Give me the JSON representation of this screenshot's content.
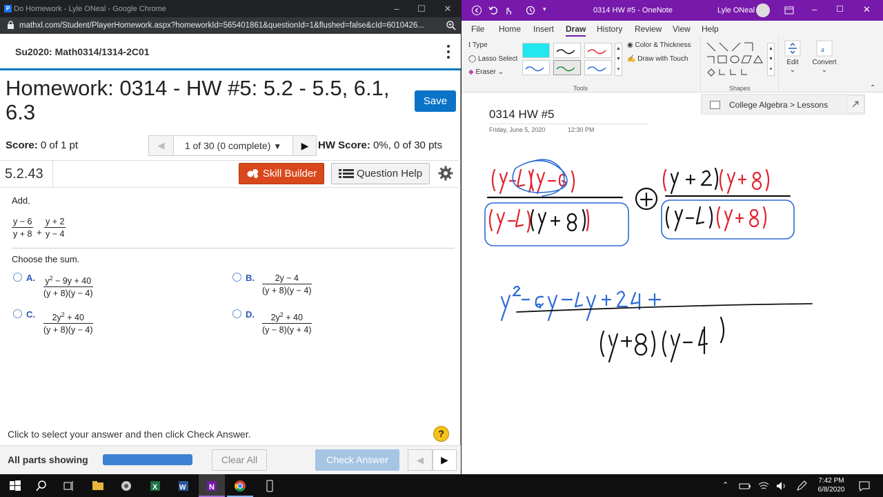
{
  "chrome": {
    "window_title": "Do Homework - Lyle ONeal - Google Chrome",
    "url": "mathxl.com/Student/PlayerHomework.aspx?homeworkId=565401861&questionId=1&flushed=false&cId=6010426...",
    "favicon_letter": "P"
  },
  "course": {
    "name": "Su2020: Math0314/1314-2C01"
  },
  "homework": {
    "title": "Homework: 0314 - HW #5: 5.2 - 5.5, 6.1, 6.3",
    "save_label": "Save",
    "score_label": "Score:",
    "score_value": "0 of 1 pt",
    "nav_select": "1 of 30 (0 complete)",
    "hw_score_label": "HW Score:",
    "hw_score_value": "0%, 0 of 30 pts"
  },
  "question": {
    "number": "5.2.43",
    "skill_builder": "Skill Builder",
    "question_help": "Question Help",
    "prompt": "Add.",
    "expr": {
      "f1_num": "y − 6",
      "f1_den": "y + 8",
      "op": "+",
      "f2_num": "y + 2",
      "f2_den": "y − 4"
    },
    "choose": "Choose the sum.",
    "options": [
      {
        "letter": "A.",
        "num_a": "y",
        "num_sup": "2",
        "num_b": " − 9y + 40",
        "den": "(y + 8)(y − 4)"
      },
      {
        "letter": "B.",
        "num_a": "2y − 4",
        "num_sup": "",
        "num_b": "",
        "den": "(y + 8)(y − 4)"
      },
      {
        "letter": "C.",
        "num_a": "2y",
        "num_sup": "2",
        "num_b": " + 40",
        "den": "(y + 8)(y − 4)"
      },
      {
        "letter": "D.",
        "num_a": "2y",
        "num_sup": "2",
        "num_b": " + 40",
        "den": "(y − 8)(y + 4)"
      }
    ]
  },
  "footer": {
    "instruction": "Click to select your answer and then click Check Answer.",
    "help": "?",
    "parts": "All parts showing",
    "progress": 1.0,
    "clear_all": "Clear All",
    "check_answer": "Check Answer"
  },
  "onenote": {
    "title": "0314 HW #5  -  OneNote",
    "user": "Lyle ONeal",
    "tabs": [
      "File",
      "Home",
      "Insert",
      "Draw",
      "History",
      "Review",
      "View",
      "Help"
    ],
    "active_tab": "Draw",
    "ribbon": {
      "type": "Type",
      "lasso": "Lasso Select",
      "eraser": "Eraser",
      "color_thickness": "Color & Thickness",
      "draw_touch": "Draw with Touch",
      "tools_group": "Tools",
      "shapes_group": "Shapes",
      "edit": "Edit",
      "convert": "Convert"
    },
    "breadcrumb": "College Algebra > Lessons",
    "page_title": "0314 HW #5",
    "page_date": "Friday, June 5, 2020",
    "page_time": "12:30 PM"
  },
  "taskbar": {
    "time": "7:42 PM",
    "date": "6/8/2020"
  },
  "colors": {
    "accent_blue": "#0a73c8",
    "skill_orange": "#d9481c",
    "onenote_purple": "#7719aa",
    "ink_red": "#e0242e",
    "ink_blue": "#2b6bd6"
  }
}
